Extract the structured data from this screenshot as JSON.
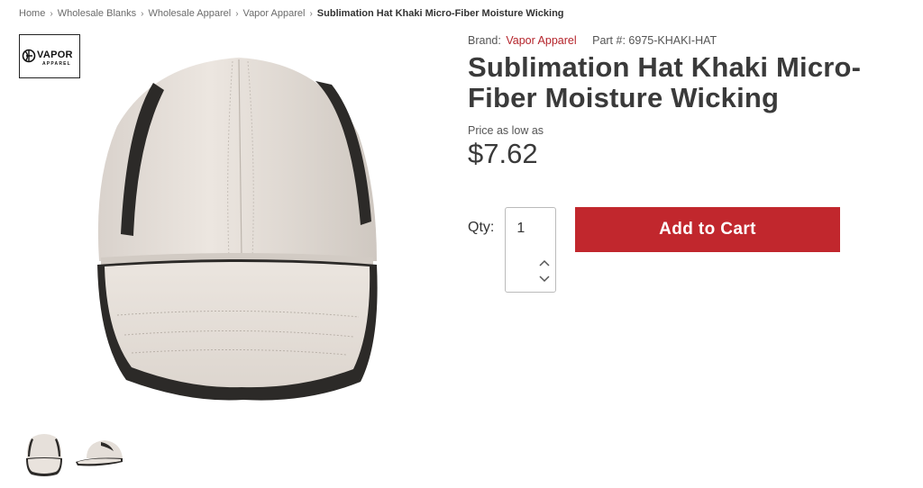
{
  "breadcrumb": {
    "items": [
      "Home",
      "Wholesale Blanks",
      "Wholesale Apparel",
      "Vapor Apparel"
    ],
    "current": "Sublimation Hat Khaki Micro-Fiber Moisture Wicking",
    "separator": "›"
  },
  "brand_logo": {
    "line1": "VAPOR",
    "line2": "APPAREL"
  },
  "product": {
    "brand_label": "Brand:",
    "brand_name": "Vapor Apparel",
    "part_label": "Part #:",
    "part_number": "6975-KHAKI-HAT",
    "title": "Sublimation Hat Khaki Micro-Fiber Moisture Wicking",
    "price_label": "Price as low as",
    "price": "$7.62"
  },
  "qty": {
    "label": "Qty:",
    "value": "1"
  },
  "cart": {
    "button_label": "Add to Cart"
  },
  "icons": {
    "stepper_up": "chevron-up-icon",
    "stepper_down": "chevron-down-icon"
  },
  "colors": {
    "accent": "#c1272d",
    "brand_link": "#b4232a",
    "hat_body": "#e8e2dc",
    "hat_trim": "#2c2a28"
  }
}
